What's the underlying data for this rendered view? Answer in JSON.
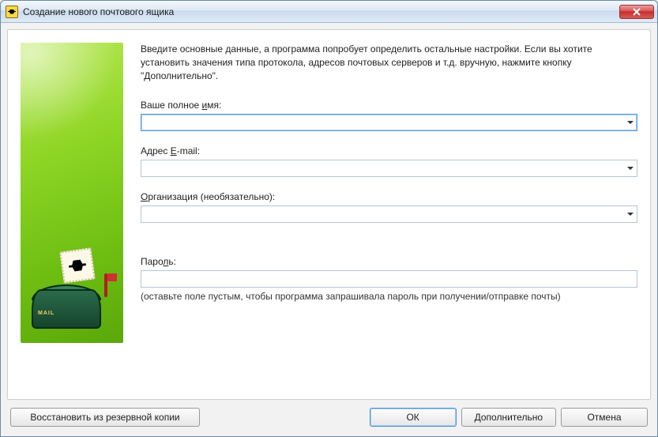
{
  "window": {
    "title": "Создание нового почтового ящика"
  },
  "intro": "Введите основные данные, а программа попробует определить остальные настройки. Если вы хотите установить значения типа протокола, адресов почтовых серверов и т.д. вручную, нажмите кнопку \"Дополнительно\".",
  "fields": {
    "name": {
      "label_pre": "Ваше полное ",
      "label_ul": "и",
      "label_post": "мя:",
      "value": ""
    },
    "email": {
      "label_pre": "Адрес ",
      "label_ul": "E",
      "label_post": "-mail:",
      "value": ""
    },
    "org": {
      "label_pre": "",
      "label_ul": "О",
      "label_post": "рганизация (необязательно):",
      "value": ""
    },
    "password": {
      "label_pre": "Паро",
      "label_ul": "л",
      "label_post": "ь:",
      "value": "",
      "hint": "(оставьте поле пустым, чтобы программа запрашивала пароль при получении/отправке почты)"
    }
  },
  "buttons": {
    "restore": "Восстановить из резервной копии",
    "ok": "ОК",
    "advanced": "Дополнительно",
    "cancel": "Отмена"
  }
}
